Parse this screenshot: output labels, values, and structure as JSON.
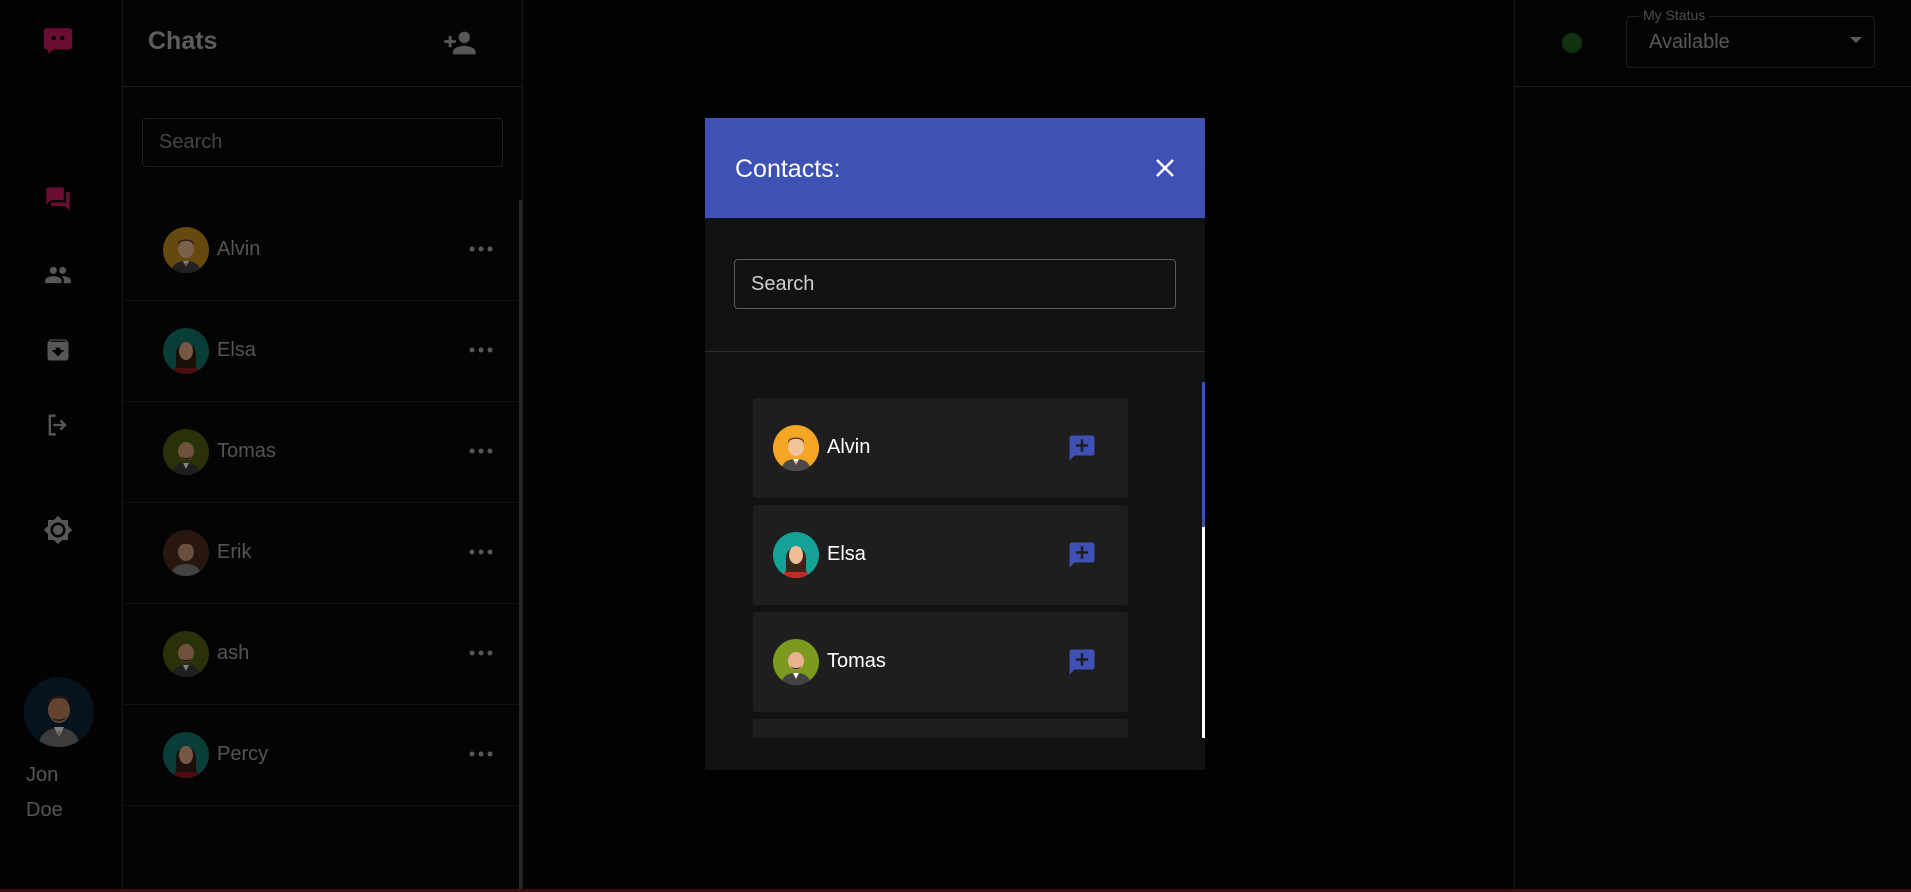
{
  "colors": {
    "brand": "#c2185b",
    "primary": "#3f51b5",
    "status_online": "#1d5b1f"
  },
  "nav": {
    "logo_icon": "chat-bubble-logo",
    "items": [
      {
        "name": "chats",
        "icon": "forum-icon",
        "active": true
      },
      {
        "name": "contacts",
        "icon": "people-icon",
        "active": false
      },
      {
        "name": "archive",
        "icon": "archive-icon",
        "active": false
      },
      {
        "name": "logout",
        "icon": "logout-icon",
        "active": false
      },
      {
        "name": "theme",
        "icon": "brightness-icon",
        "active": false
      }
    ],
    "user": {
      "first_name": "Jon",
      "last_name": "Doe"
    }
  },
  "chats": {
    "title": "Chats",
    "add_icon": "person-add-icon",
    "search_placeholder": "Search",
    "items": [
      {
        "name": "Alvin",
        "avatar": "man-orange"
      },
      {
        "name": "Elsa",
        "avatar": "woman-teal"
      },
      {
        "name": "Tomas",
        "avatar": "man-olive"
      },
      {
        "name": "Erik",
        "avatar": "man-brown"
      },
      {
        "name": "ash",
        "avatar": "man-olive"
      },
      {
        "name": "Percy",
        "avatar": "woman-teal"
      }
    ]
  },
  "status": {
    "legend": "My Status",
    "value": "Available"
  },
  "modal": {
    "title": "Contacts:",
    "search_placeholder": "Search",
    "contacts": [
      {
        "name": "Alvin",
        "avatar": "man-orange"
      },
      {
        "name": "Elsa",
        "avatar": "woman-teal"
      },
      {
        "name": "Tomas",
        "avatar": "man-olive"
      }
    ]
  }
}
